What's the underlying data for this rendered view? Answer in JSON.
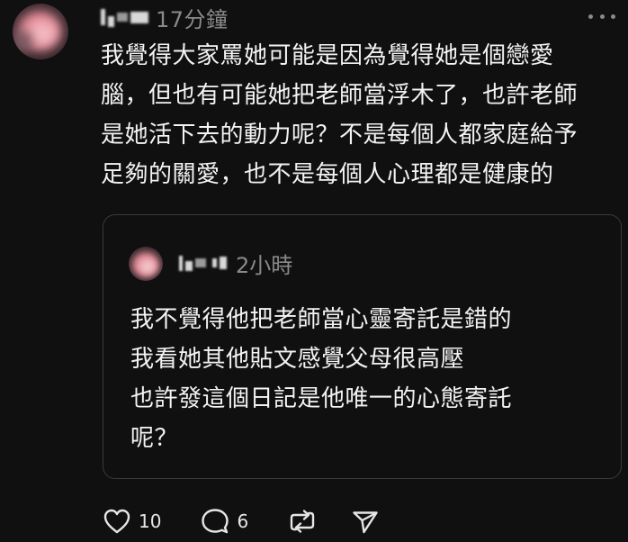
{
  "post": {
    "username": "",
    "timestamp": "17分鐘",
    "text": "我覺得大家罵她可能是因為覺得她是個戀愛\n腦，但也有可能她把老師當浮木了，也許老師\n是她活下去的動力呢？不是每個人都家庭給予\n足夠的關愛，也不是每個人心理都是健康的"
  },
  "quote": {
    "username": "",
    "timestamp": "2小時",
    "lines": [
      "我不覺得他把老師當心靈寄託是錯的",
      "我看她其他貼文感覺父母很高壓",
      "也許發這個日記是他唯一的心態寄託",
      "呢？"
    ]
  },
  "actions": {
    "like_count": "10",
    "comment_count": "6"
  },
  "icons": {
    "more": "more-horizontal-icon",
    "like": "heart-icon",
    "comment": "comment-bubble-icon",
    "repost": "repost-icon",
    "share": "send-icon"
  },
  "colors": {
    "background": "#101010",
    "text": "#f3f3f3",
    "muted": "#8a8a8a",
    "border": "#3a3a3a"
  }
}
